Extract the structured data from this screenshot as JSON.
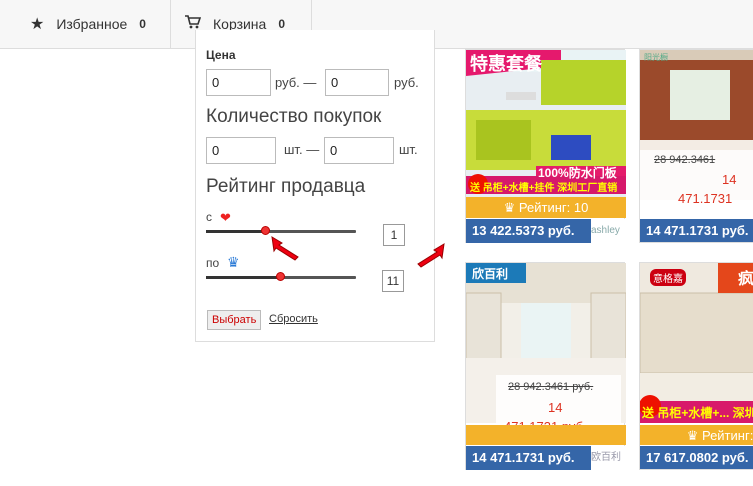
{
  "topbar": {
    "favorites": {
      "label": "Избранное",
      "count": "0",
      "icon": "star-icon"
    },
    "cart": {
      "label": "Корзина",
      "count": "0",
      "icon": "cart-icon"
    }
  },
  "filter": {
    "price_label": "Цена",
    "price_from": "0",
    "price_to": "0",
    "currency_unit": "руб.",
    "dash": "—",
    "purchases_title": "Количество покупок",
    "purchases_from": "0",
    "purchases_to": "0",
    "qty_unit": "шт.",
    "rating_title": "Рейтинг продавца",
    "from_label": "с",
    "to_label": "по",
    "from_value": "1",
    "to_value": "11",
    "from_level": 0.4,
    "to_level": 0.5,
    "apply_button": "Выбрать",
    "reset_link": "Сбросить"
  },
  "products": [
    {
      "banner_top": "特惠套餐",
      "banner_1": "100%防水门板",
      "banner_2": "送 吊柜+水槽+挂件 深圳工厂直销",
      "rating": "Рейтинг: 10",
      "price": "13 422.5373 руб.",
      "brand": "ashley"
    },
    {
      "banner_top": "阳光橱",
      "old_price": "28 942.3461",
      "new_price_1": "14",
      "new_price_2": "471.1731",
      "price": "14 471.1731 руб."
    },
    {
      "banner_top": "欣百利",
      "old_price": "28 942.3461 руб.",
      "new_price_1": "14",
      "new_price_2": "471.1731 руб.",
      "price": "14 471.1731 руб.",
      "brand": "欧百利"
    },
    {
      "banner_top": "意格嘉",
      "banner_corner": "疯",
      "banner_bottom": "送 吊柜+水槽+... 深圳",
      "rating": "Рейтинг:",
      "price": "17 617.0802 руб."
    }
  ],
  "colors": {
    "rating_bar": "#f3b22a",
    "price_bar": "#3566a8",
    "accent_red": "#d32"
  }
}
